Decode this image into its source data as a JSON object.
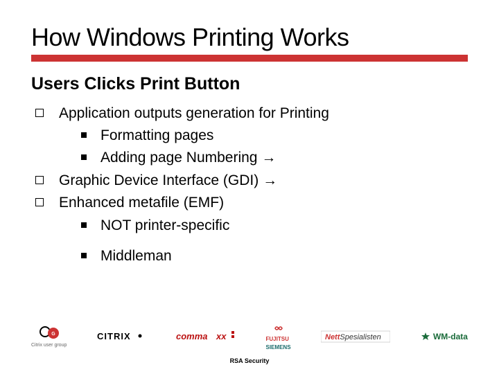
{
  "title": "How Windows Printing Works",
  "subtitle": "Users Clicks Print Button",
  "accent_color": "#cc3333",
  "bullets": {
    "b1": "Application outputs generation for Printing",
    "b1a": "Formatting pages",
    "b1b": "Adding page Numbering →",
    "b2": "Graphic Device Interface (GDI) →",
    "b3": "Enhanced metafile (EMF)",
    "b3a": "NOT printer-specific",
    "b3b": "Middleman"
  },
  "footer": {
    "caption": "RSA Security",
    "logos": {
      "cug_sub": "Citrix user group",
      "citrix": "CITRIX",
      "commaxx": "commaxx",
      "fujitsu_top": "FUJITSU",
      "fujitsu_bottom": "SIEMENS",
      "nettspes": "NettSpesialisten",
      "wmdata": "WM-data"
    }
  }
}
